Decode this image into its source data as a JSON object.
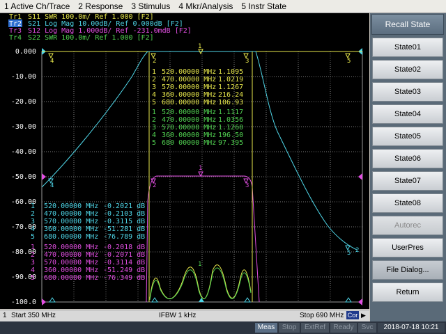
{
  "menu": [
    "1 Active Ch/Trace",
    "2 Response",
    "3 Stimulus",
    "4 Mkr/Analysis",
    "5 Instr State"
  ],
  "traces": [
    {
      "name": "Tr1",
      "text": "S11  SWR 100.0m/ Ref 1.000  [F2]",
      "color": "#e8e84c"
    },
    {
      "name": "Tr2",
      "text": "S21  Log Mag 10.00dB/ Ref 0.000dB  [F2]",
      "color": "#4fd6e8"
    },
    {
      "name": "Tr3",
      "text": "S12  Log Mag 1.000dB/ Ref -231.0mdB  [F2]",
      "color": "#e24fe2"
    },
    {
      "name": "Tr4",
      "text": "S22  SWR 100.0m/ Ref 1.000  [F2]",
      "color": "#52d452"
    }
  ],
  "yaxis": [
    "0.000",
    "-10.00",
    "-20.00",
    "-30.00",
    "-40.00",
    "-50.00",
    "-60.00",
    "-70.00",
    "-80.00",
    "-90.00",
    "-100.0"
  ],
  "marker_tables": [
    {
      "color": "#e8e84c",
      "rows": [
        [
          "1",
          "520.00000 MHz",
          "1.1095"
        ],
        [
          "2",
          "470.00000 MHz",
          "1.0219"
        ],
        [
          "3",
          "570.00000 MHz",
          "1.1267"
        ],
        [
          "4",
          "360.00000 MHz",
          "216.24"
        ],
        [
          "5",
          "680.00000 MHz",
          "106.93"
        ]
      ]
    },
    {
      "color": "#52d452",
      "rows": [
        [
          "1",
          "520.00000 MHz",
          "1.1117"
        ],
        [
          "2",
          "470.00000 MHz",
          "1.0356"
        ],
        [
          "3",
          "570.00000 MHz",
          "1.1260"
        ],
        [
          "4",
          "360.00000 MHz",
          "196.50"
        ],
        [
          "5",
          "680 00000 MHz",
          "97.395"
        ]
      ]
    },
    {
      "color": "#4fd6e8",
      "rows": [
        [
          "1",
          "520.00000 MHz",
          "-0.2021 dB"
        ],
        [
          "2",
          "470.00000 MHz",
          "-0.2103 dB"
        ],
        [
          "3",
          "570.00000 MHz",
          "-0.3115 dB"
        ],
        [
          "4",
          "360.00000 MHz",
          "-51.281 dB"
        ],
        [
          "5",
          "680.00000 MHz",
          "-76.789 dB"
        ]
      ]
    },
    {
      "color": "#e24fe2",
      "rows": [
        [
          "1",
          "520.00000 MHz",
          "-0.2018 dB"
        ],
        [
          "2",
          "470.00000 MHz",
          "-0.2071 dB"
        ],
        [
          "3",
          "570.00000 MHz",
          "-0.3114 dB"
        ],
        [
          "4",
          "360.00000 MHz",
          "-51.249 dB"
        ],
        [
          "5",
          "680.00000 MHz",
          "-76.349 dB"
        ]
      ]
    }
  ],
  "bottom": {
    "channel": "1",
    "start": "Start 350 MHz",
    "ifbw": "IFBW 1 kHz",
    "stop": "Stop 690 MHz",
    "cor": "Cor"
  },
  "right_panel": {
    "title": "Recall State",
    "buttons": [
      "State01",
      "State02",
      "State03",
      "State04",
      "State05",
      "State06",
      "State07",
      "State08",
      "Autorec",
      "UserPres",
      "File Dialog...",
      "Return"
    ]
  },
  "status": [
    "Meas",
    "Stop",
    "ExtRef",
    "Ready",
    "Svc",
    "2018-07-18 10:21"
  ],
  "chart_data": {
    "type": "line",
    "x_range_mhz": [
      350,
      690
    ],
    "ylim": [
      -100,
      0
    ],
    "grid": true,
    "series": [
      {
        "name": "Tr1 S11",
        "x": [
          470,
          520,
          570,
          360,
          680
        ],
        "values": [
          1.0219,
          1.1095,
          1.1267,
          216.24,
          106.93
        ]
      },
      {
        "name": "Tr2 S21",
        "x": [
          360,
          470,
          520,
          570,
          680
        ],
        "values": [
          -51.281,
          -0.2103,
          -0.2021,
          -0.3115,
          -76.789
        ]
      },
      {
        "name": "Tr3 S12",
        "x": [
          360,
          470,
          520,
          570,
          680
        ],
        "values": [
          -51.249,
          -0.2071,
          -0.2018,
          -0.3114,
          -76.349
        ]
      },
      {
        "name": "Tr4 S22",
        "x": [
          470,
          520,
          570,
          360,
          680
        ],
        "values": [
          1.0356,
          1.1117,
          1.126,
          196.5,
          97.395
        ]
      }
    ]
  }
}
